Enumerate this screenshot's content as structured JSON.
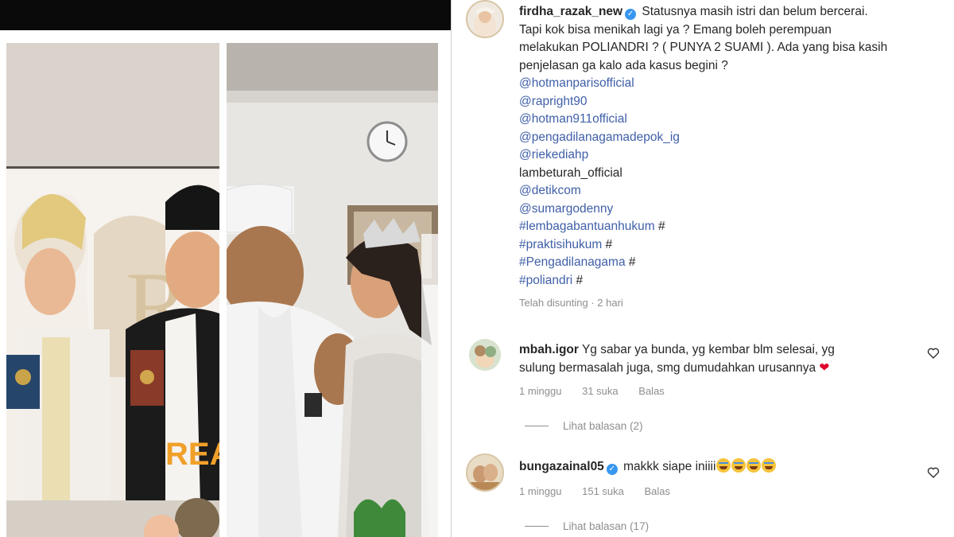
{
  "post": {
    "author": "firdha_razak_new",
    "verified_mark": "✓",
    "caption_lines": [
      "Statusnya masih istri dan belum bercerai.",
      "Tapi kok bisa menikah lagi ya ? Emang boleh perempuan",
      "melakukan POLIANDRI ? ( PUNYA 2 SUAMI ). Ada yang bisa kasih",
      "penjelasan ga kalo ada kasus begini ?"
    ],
    "mentions": [
      "@hotmanparisofficial",
      "@rapright90",
      "@hotman911official",
      "@pengadilanagamadepok_ig",
      "@riekediahp"
    ],
    "plain_mention": "lambeturah_official",
    "mentions2": [
      "@detikcom",
      "@sumargodenny"
    ],
    "hashtags": [
      {
        "tag": "#lembagabantuanhukum",
        "suffix": " #"
      },
      {
        "tag": "#praktisihukum",
        "suffix": " #"
      },
      {
        "tag": "#Pengadilanagama",
        "suffix": " #"
      },
      {
        "tag": "#poliandri",
        "suffix": " #"
      }
    ],
    "edited_time": "Telah disunting · 2 hari"
  },
  "comments": [
    {
      "author": "mbah.igor",
      "text_line1": "Yg sabar ya bunda, yg kembar blm selesai, yg",
      "text_line2": "sulung bermasalah juga, smg dumudahkan urusannya",
      "heart_emoji": "❤",
      "time": "1 minggu",
      "likes": "31 suka",
      "reply": "Balas",
      "view_replies": "Lihat balasan (2)"
    },
    {
      "author": "bungazainal05",
      "verified_mark": "✓",
      "text": "makkk siape iniiii",
      "time": "1 minggu",
      "likes": "151 suka",
      "reply": "Balas",
      "view_replies": "Lihat balasan (17)"
    }
  ],
  "icons": {
    "like": "heart-outline-icon"
  },
  "colors": {
    "link": "#3f5fa8",
    "meta": "#8e8e8e",
    "verified": "#3897f0"
  }
}
